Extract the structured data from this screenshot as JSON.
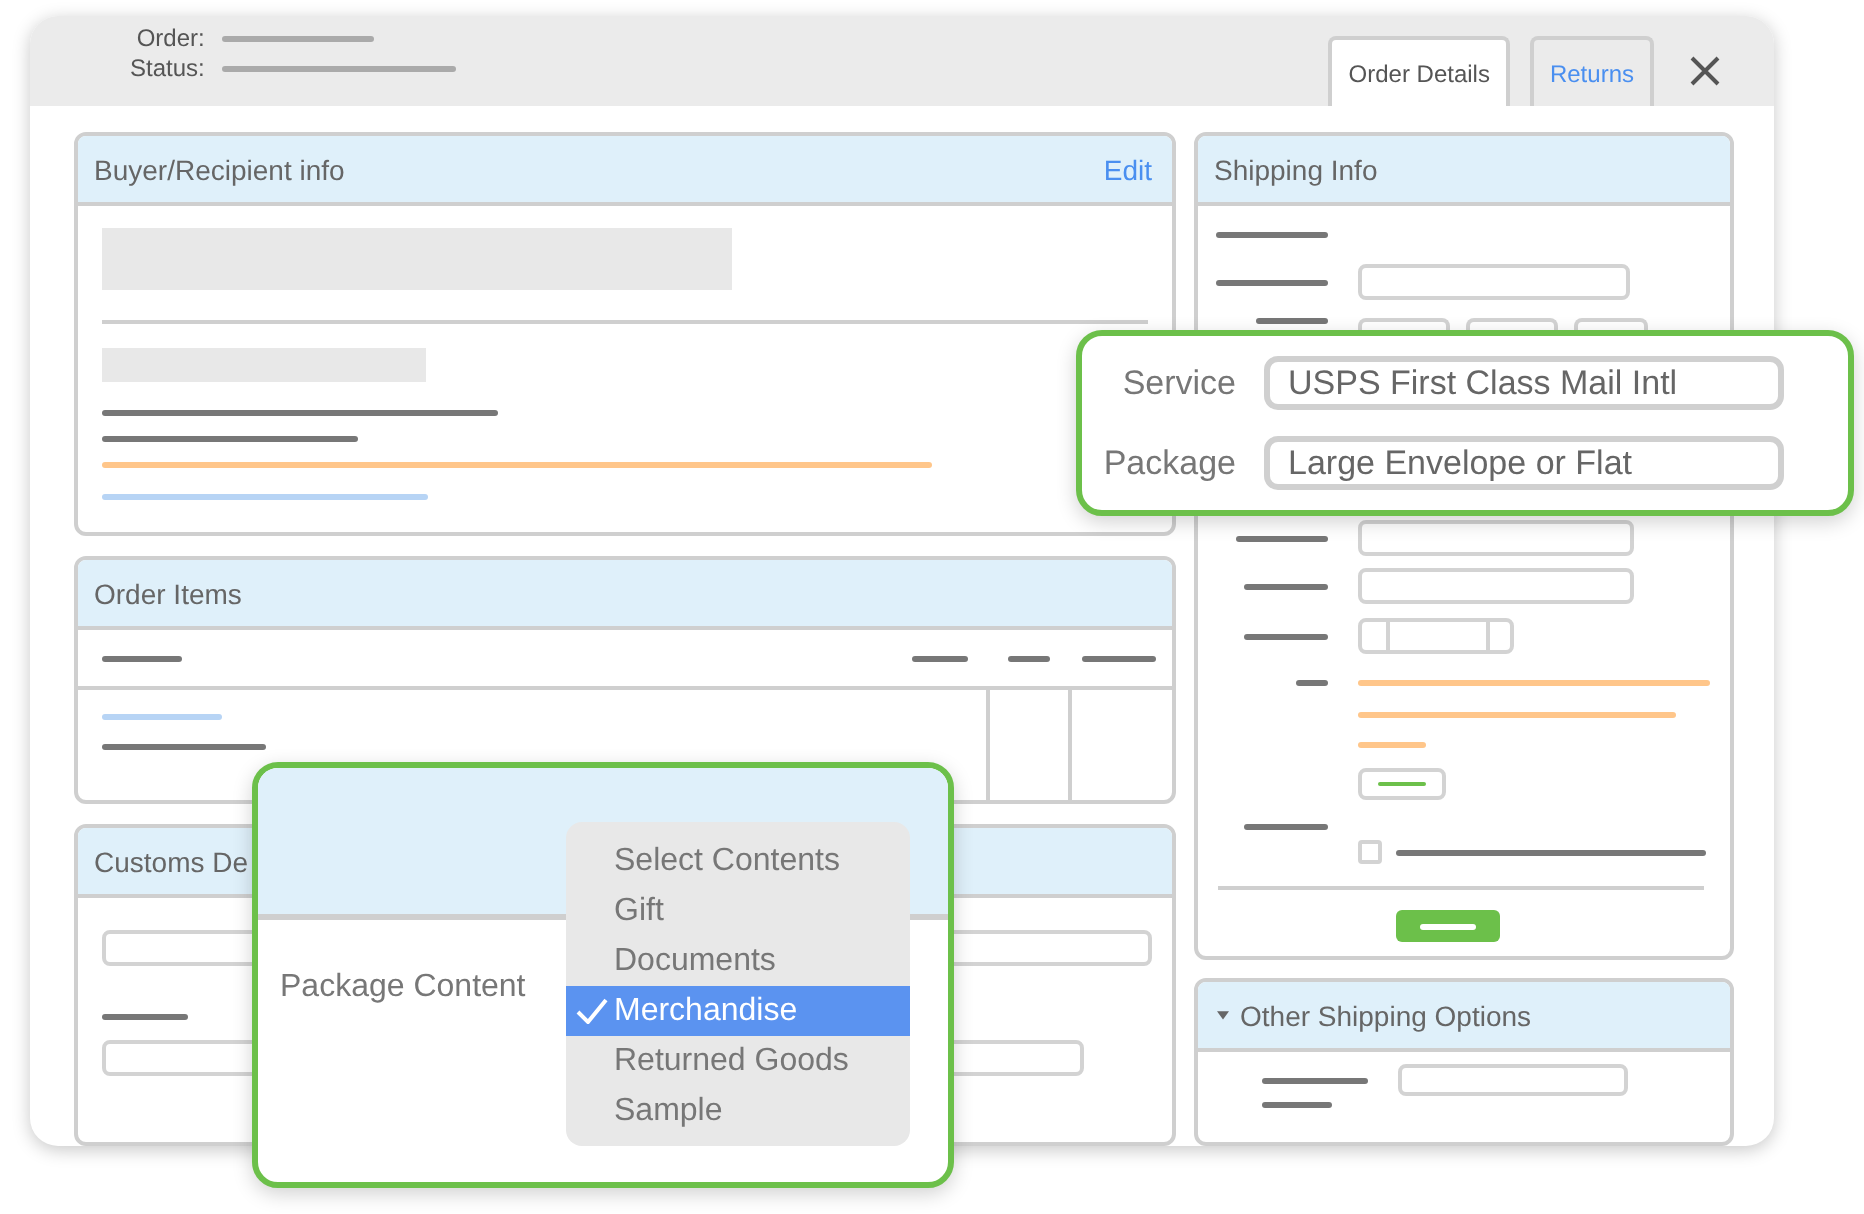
{
  "header": {
    "order_label": "Order:",
    "status_label": "Status:"
  },
  "tabs": [
    {
      "label": "Order Details",
      "selected": true
    },
    {
      "label": "Returns",
      "selected": false
    }
  ],
  "panels": {
    "buyer": {
      "title": "Buyer/Recipient info",
      "action": "Edit"
    },
    "order_items": {
      "title": "Order Items"
    },
    "customs": {
      "title": "Customs De"
    },
    "shipping_info": {
      "title": "Shipping Info",
      "option_checked": false
    },
    "other_shipping": {
      "title": "Other Shipping Options",
      "expanded": true
    }
  },
  "service_callout": {
    "fields": [
      {
        "label": "Service",
        "value": "USPS First Class Mail Intl"
      },
      {
        "label": "Package",
        "value": "Large Envelope or Flat"
      }
    ]
  },
  "content_callout": {
    "label": "Package Content",
    "options": [
      {
        "label": "Select Contents",
        "selected": false
      },
      {
        "label": "Gift",
        "selected": false
      },
      {
        "label": "Documents",
        "selected": false
      },
      {
        "label": "Merchandise",
        "selected": true
      },
      {
        "label": "Returned Goods",
        "selected": false
      },
      {
        "label": "Sample",
        "selected": false
      }
    ]
  }
}
